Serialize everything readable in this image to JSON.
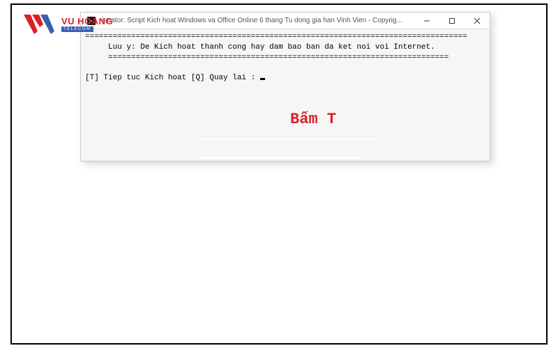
{
  "logo": {
    "name": "VU HOANG",
    "sub": "TELECOM"
  },
  "window": {
    "title": "istrator:  Script Kich hoat Windows va Office Online 6 thang Tu dong gia han Vinh Vien - Copyrig..."
  },
  "console": {
    "rule1": "===================================================================================",
    "notice": "     Luu y: De Kich hoat thanh cong hay dam bao ban da ket noi voi Internet.",
    "rule2": "     ==========================================================================",
    "prompt": "[T] Tiep tuc Kich hoat [Q] Quay lai : "
  },
  "annotation": {
    "text": "Bấm T"
  }
}
